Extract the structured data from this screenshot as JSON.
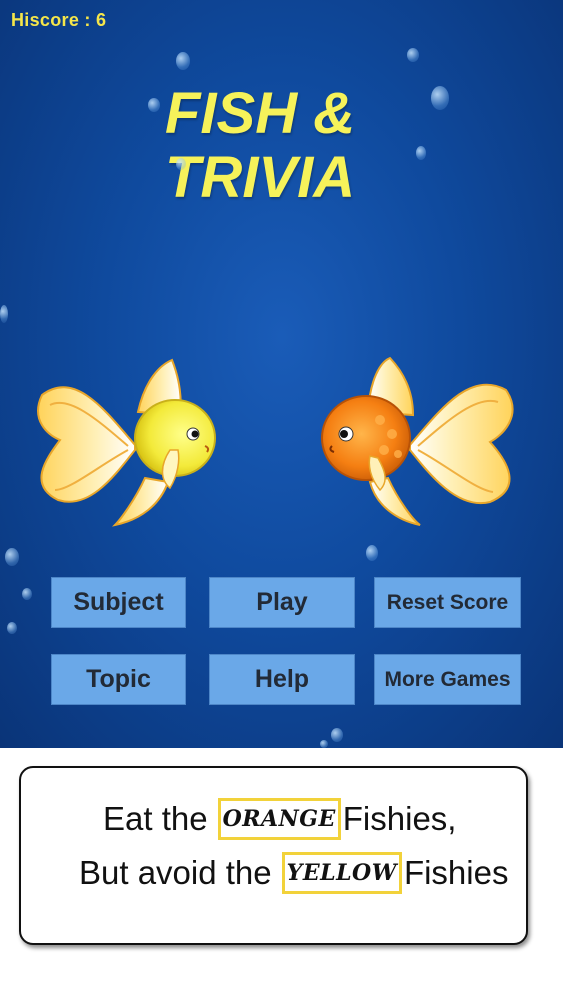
{
  "hiscore": {
    "text": "Hiscore : 6"
  },
  "title": {
    "line1": "FISH &",
    "line2": "TRIVIA"
  },
  "buttons": {
    "subject": "Subject",
    "play": "Play",
    "reset_score": "Reset Score",
    "topic": "Topic",
    "help": "Help",
    "more_games": "More Games"
  },
  "instructions": {
    "line1_prefix": "Eat the",
    "line1_tag": "ORANGE",
    "line1_suffix": "Fishies,",
    "line2_prefix": "But avoid the",
    "line2_tag": "YELLOW",
    "line2_suffix": "Fishies"
  },
  "colors": {
    "title": "#f6f25a",
    "hiscore": "#f5e64a",
    "button": "#6aa8e8",
    "tag_border": "#f2d23a",
    "water": "#1a5cb8"
  }
}
